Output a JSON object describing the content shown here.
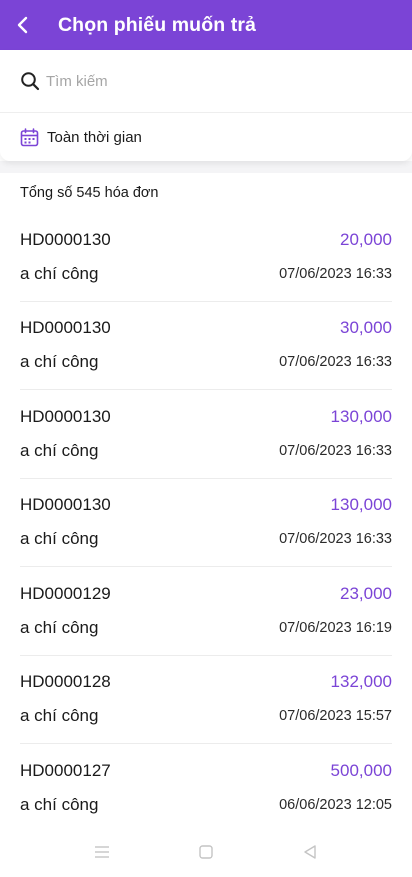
{
  "header": {
    "title": "Chọn phiếu muốn trả",
    "back_icon": "chevron-left-icon",
    "background": "#7b44d6"
  },
  "search": {
    "placeholder": "Tìm kiếm",
    "value": "",
    "icon": "search-icon"
  },
  "date_filter": {
    "label": "Toàn thời gian",
    "icon": "calendar-icon"
  },
  "summary": {
    "text": "Tổng số 545 hóa đơn"
  },
  "accent_color": "#7b44d6",
  "invoices": [
    {
      "code": "HD0000130",
      "amount": "20,000",
      "customer": "a chí công",
      "datetime": "07/06/2023 16:33"
    },
    {
      "code": "HD0000130",
      "amount": "30,000",
      "customer": "a chí công",
      "datetime": "07/06/2023 16:33"
    },
    {
      "code": "HD0000130",
      "amount": "130,000",
      "customer": "a chí công",
      "datetime": "07/06/2023 16:33"
    },
    {
      "code": "HD0000130",
      "amount": "130,000",
      "customer": "a chí công",
      "datetime": "07/06/2023 16:33"
    },
    {
      "code": "HD0000129",
      "amount": "23,000",
      "customer": "a chí công",
      "datetime": "07/06/2023 16:19"
    },
    {
      "code": "HD0000128",
      "amount": "132,000",
      "customer": "a chí công",
      "datetime": "07/06/2023 15:57"
    },
    {
      "code": "HD0000127",
      "amount": "500,000",
      "customer": "a chí công",
      "datetime": "06/06/2023 12:05"
    }
  ],
  "system_nav": {
    "menu_icon": "menu-icon",
    "home_icon": "square-home-icon",
    "back_icon": "triangle-back-icon"
  }
}
